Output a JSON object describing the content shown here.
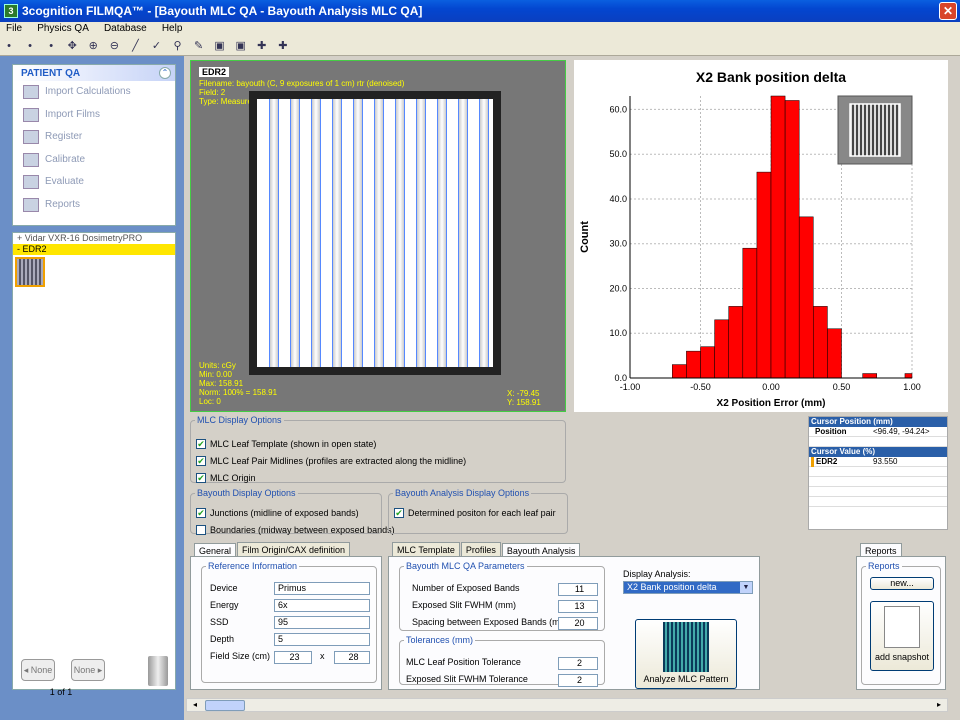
{
  "window": {
    "title": "3cognition FILMQA™ - [Bayouth MLC QA - Bayouth Analysis MLC QA]"
  },
  "menu": [
    "File",
    "Physics QA",
    "Database",
    "Help"
  ],
  "sidebar": {
    "header": "PATIENT QA",
    "items": [
      {
        "label": "Import Calculations",
        "icon": "calculation-import-icon"
      },
      {
        "label": "Import Films",
        "icon": "film-import-icon"
      },
      {
        "label": "Register",
        "icon": "register-icon"
      },
      {
        "label": "Calibrate",
        "icon": "calibrate-icon"
      },
      {
        "label": "Evaluate",
        "icon": "evaluate-icon"
      },
      {
        "label": "Reports",
        "icon": "reports-icon"
      }
    ],
    "tree": [
      {
        "label": "+ Vidar VXR-16 DosimetryPRO"
      },
      {
        "label": "- EDR2"
      }
    ],
    "nav_prev": "None",
    "nav_next": "None",
    "pager": "1 of 1"
  },
  "film": {
    "name": "EDR2",
    "info_lines": [
      "Filename: bayouth (C, 9 exposures of 1 cm) rtr (denoised)",
      "Field: 2",
      "Type:    Measurement"
    ],
    "stats_lines": [
      "Units: cGy",
      "Min:   0.00",
      "Max:   158.91",
      "Norm:  100% = 158.91",
      "Loc:   0"
    ],
    "coord_lines": [
      "X:  -79.45",
      "Y:  158.91"
    ]
  },
  "chart_data": {
    "type": "bar",
    "title": "X2 Bank position delta",
    "xlabel": "X2 Position Error (mm)",
    "ylabel": "Count",
    "xlim": [
      -1.0,
      1.0
    ],
    "ylim": [
      0,
      63
    ],
    "xticks": [
      "-1.00",
      "-0.50",
      "0.00",
      "0.50",
      "1.00"
    ],
    "yticks": [
      "0.0",
      "10.0",
      "20.0",
      "30.0",
      "40.0",
      "50.0",
      "60.0"
    ],
    "bins": [
      {
        "x0": -0.7,
        "x1": -0.6,
        "count": 3
      },
      {
        "x0": -0.6,
        "x1": -0.5,
        "count": 6
      },
      {
        "x0": -0.5,
        "x1": -0.4,
        "count": 7
      },
      {
        "x0": -0.4,
        "x1": -0.3,
        "count": 13
      },
      {
        "x0": -0.3,
        "x1": -0.2,
        "count": 16
      },
      {
        "x0": -0.2,
        "x1": -0.1,
        "count": 29
      },
      {
        "x0": -0.1,
        "x1": 0.0,
        "count": 46
      },
      {
        "x0": 0.0,
        "x1": 0.1,
        "count": 63
      },
      {
        "x0": 0.1,
        "x1": 0.2,
        "count": 62
      },
      {
        "x0": 0.2,
        "x1": 0.3,
        "count": 36
      },
      {
        "x0": 0.3,
        "x1": 0.4,
        "count": 16
      },
      {
        "x0": 0.4,
        "x1": 0.5,
        "count": 11
      },
      {
        "x0": 0.65,
        "x1": 0.75,
        "count": 1
      },
      {
        "x0": 0.95,
        "x1": 1.0,
        "count": 1
      }
    ],
    "bar_color": "#ff0000",
    "grid": true
  },
  "cursor": {
    "position_header": "Cursor Position (mm)",
    "position_key": "Position",
    "position_value": "<96.49, -94.24>",
    "value_header": "Cursor Value (%)",
    "value_key": "EDR2",
    "value_value": "93.550"
  },
  "mlc_display": {
    "legend": "MLC Display Options",
    "options": [
      {
        "label": "MLC Leaf Template (shown in open state)",
        "checked": true
      },
      {
        "label": "MLC Leaf Pair Midlines (profiles are extracted along the midline)",
        "checked": true
      },
      {
        "label": "MLC Origin",
        "checked": true
      }
    ]
  },
  "bayouth_display": {
    "legend": "Bayouth Display Options",
    "options": [
      {
        "label": "Junctions (midline of exposed bands)",
        "checked": true
      },
      {
        "label": "Boundaries (midway between exposed bands)",
        "checked": false
      }
    ]
  },
  "bayouth_analysis_display": {
    "legend": "Bayouth Analysis Display Options",
    "options": [
      {
        "label": "Determined positon for each leaf pair",
        "checked": true
      }
    ]
  },
  "general_tabs": [
    "General",
    "Film Origin/CAX definition"
  ],
  "reference": {
    "legend": "Reference Information",
    "device_label": "Device",
    "device": "Primus",
    "energy_label": "Energy",
    "energy": "6x",
    "ssd_label": "SSD",
    "ssd": "95",
    "depth_label": "Depth",
    "depth": "5",
    "field_label": "Field Size (cm)",
    "field_x": "23",
    "field_sep": "x",
    "field_y": "28"
  },
  "analysis_tabs": [
    "MLC Template",
    "Profiles",
    "Bayouth Analysis"
  ],
  "params": {
    "legend": "Bayouth MLC QA Parameters",
    "bands_label": "Number of Exposed Bands",
    "bands": "11",
    "fwhm_label": "Exposed Slit FWHM (mm)",
    "fwhm": "13",
    "spacing_label": "Spacing between Exposed Bands (mm)",
    "spacing": "20"
  },
  "tolerances": {
    "legend": "Tolerances (mm)",
    "leaf_label": "MLC Leaf Position Tolerance",
    "leaf": "2",
    "fwhm_label": "Exposed Slit FWHM Tolerance",
    "fwhm": "2"
  },
  "display_analysis": {
    "label": "Display Analysis:",
    "selected": "X2 Bank position delta"
  },
  "analyze_button": "Analyze MLC Pattern",
  "reports": {
    "tab": "Reports",
    "legend": "Reports",
    "new_button": "new...",
    "snapshot_button": "add snapshot"
  }
}
